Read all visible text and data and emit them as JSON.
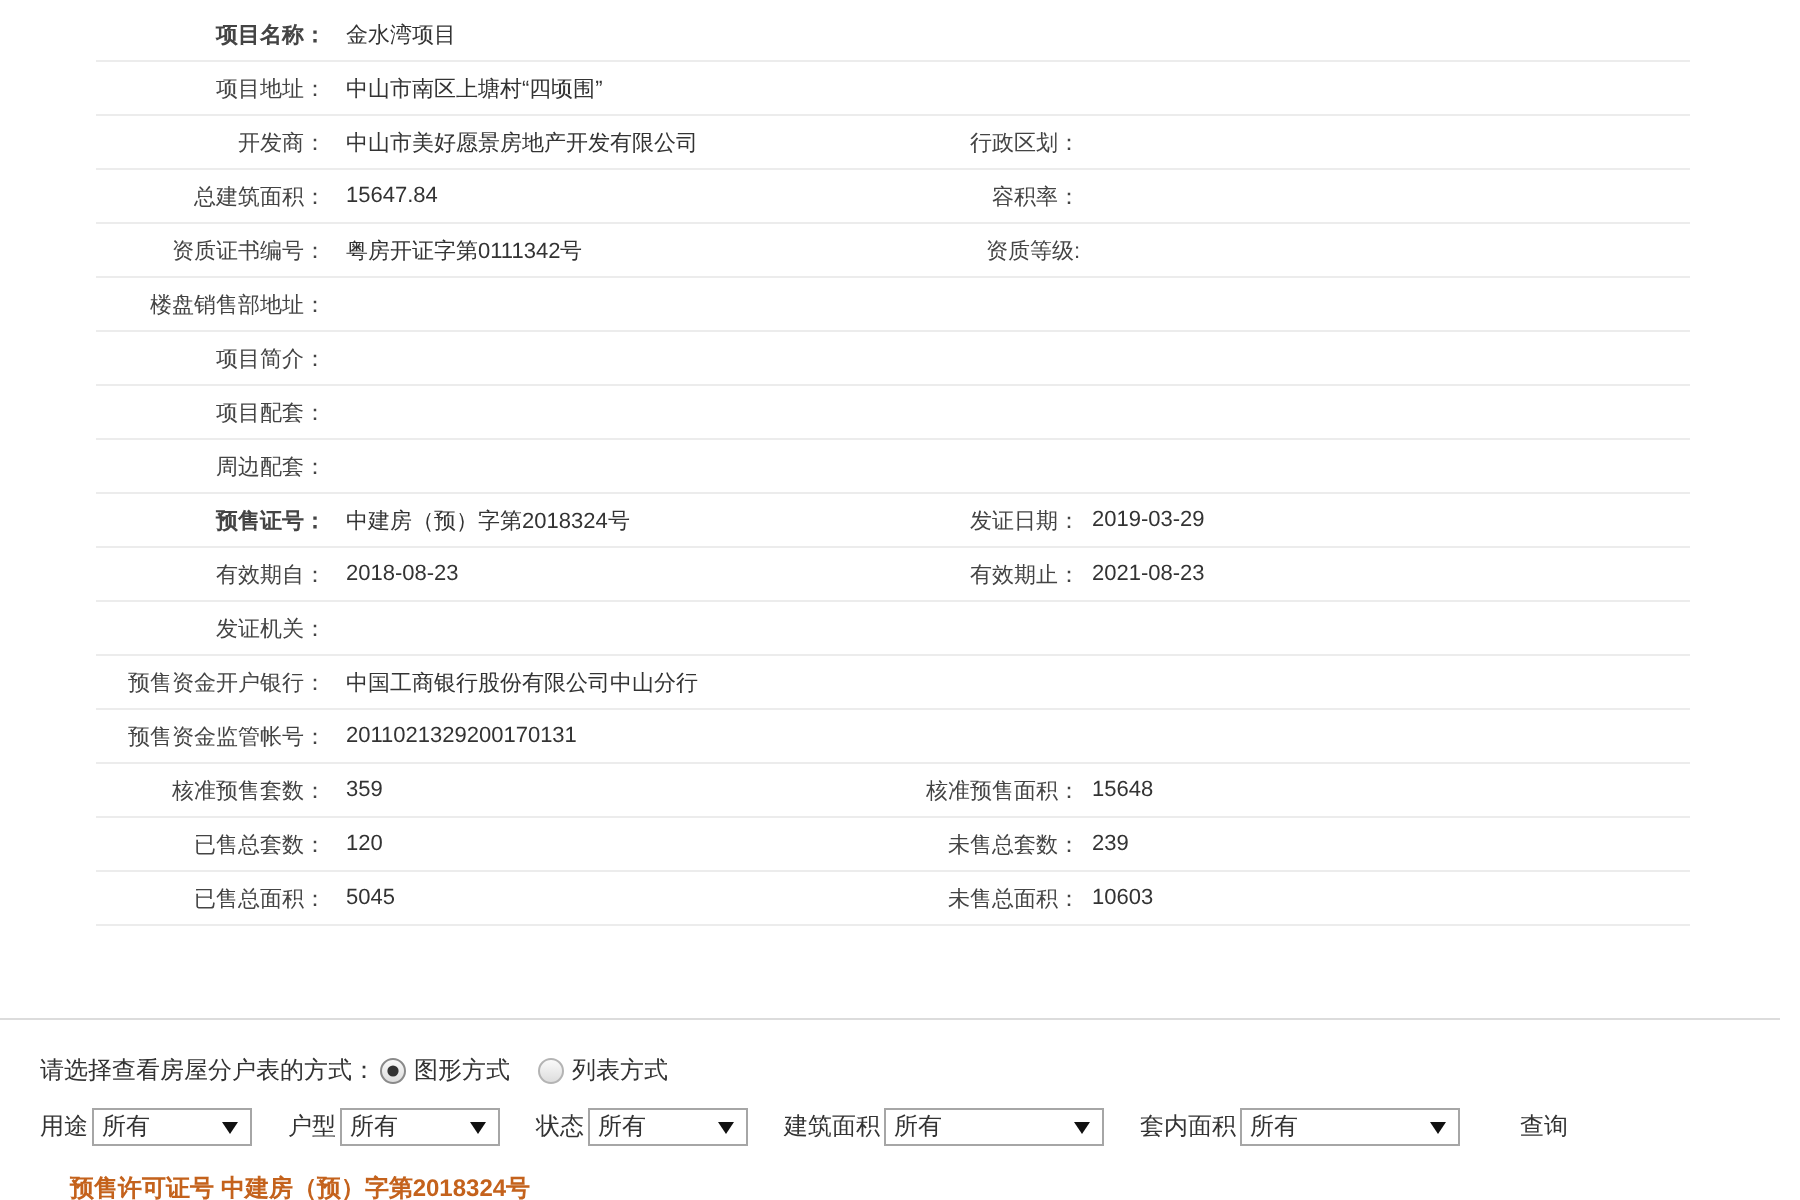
{
  "project_details": {
    "rows": [
      {
        "fields": [
          {
            "label": "项目名称：",
            "value": "金水湾项目",
            "bold": true
          }
        ]
      },
      {
        "fields": [
          {
            "label": "项目地址：",
            "value": "中山市南区上塘村“四顷围”",
            "bold": false
          }
        ]
      },
      {
        "fields": [
          {
            "label": "开发商：",
            "value": "中山市美好愿景房地产开发有限公司",
            "bold": false
          },
          {
            "label": "行政区划：",
            "bold": false
          }
        ]
      },
      {
        "fields": [
          {
            "label": "总建筑面积：",
            "value": "15647.84",
            "bold": false
          },
          {
            "label": "容积率：",
            "bold": false
          }
        ]
      },
      {
        "fields": [
          {
            "label": "资质证书编号：",
            "value": "粤房开证字第0111342号",
            "bold": false
          },
          {
            "label": "资质等级:",
            "bold": false
          }
        ]
      },
      {
        "fields": [
          {
            "label": "楼盘销售部地址：",
            "bold": false
          }
        ]
      },
      {
        "fields": [
          {
            "label": "项目简介：",
            "bold": false
          }
        ]
      },
      {
        "fields": [
          {
            "label": "项目配套：",
            "bold": false
          }
        ]
      },
      {
        "fields": [
          {
            "label": "周边配套：",
            "bold": false
          }
        ]
      },
      {
        "fields": [
          {
            "label": "预售证号：",
            "value": "中建房（预）字第2018324号",
            "bold": true
          },
          {
            "label": "发证日期：",
            "value": "2019-03-29",
            "bold": false
          }
        ]
      },
      {
        "fields": [
          {
            "label": "有效期自：",
            "value": "2018-08-23",
            "bold": false
          },
          {
            "label": "有效期止：",
            "value": "2021-08-23",
            "bold": false
          }
        ]
      },
      {
        "fields": [
          {
            "label": "发证机关：",
            "bold": false
          }
        ]
      },
      {
        "fields": [
          {
            "label": "预售资金开户银行：",
            "value": "中国工商银行股份有限公司中山分行",
            "bold": false
          }
        ]
      },
      {
        "fields": [
          {
            "label": "预售资金监管帐号：",
            "value": "2011021329200170131",
            "bold": false
          }
        ]
      },
      {
        "fields": [
          {
            "label": "核准预售套数：",
            "value": "359",
            "bold": false
          },
          {
            "label": "核准预售面积：",
            "value": "15648",
            "bold": false
          }
        ]
      },
      {
        "fields": [
          {
            "label": "已售总套数：",
            "value": "120",
            "bold": false
          },
          {
            "label": "未售总套数：",
            "value": "239",
            "bold": false
          }
        ]
      },
      {
        "fields": [
          {
            "label": "已售总面积：",
            "value": "5045",
            "bold": false
          },
          {
            "label": "未售总面积：",
            "value": "10603",
            "bold": false
          }
        ]
      }
    ]
  },
  "view_mode": {
    "prompt": "请选择查看房屋分户表的方式：",
    "options": [
      {
        "label": "图形方式",
        "selected": true
      },
      {
        "label": "列表方式",
        "selected": false
      }
    ]
  },
  "filters": [
    {
      "label": "用途",
      "value": "所有"
    },
    {
      "label": "户型",
      "value": "所有"
    },
    {
      "label": "状态",
      "value": "所有"
    },
    {
      "label": "建筑面积",
      "value": "所有"
    },
    {
      "label": "套内面积",
      "value": "所有"
    }
  ],
  "query_link": "查询",
  "permit_heading": "预售许可证号 中建房（预）字第2018324号"
}
